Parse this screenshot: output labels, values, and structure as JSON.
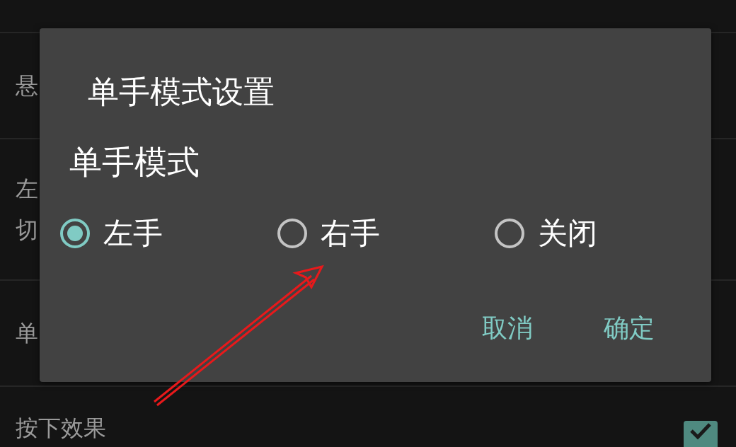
{
  "background_list": [
    {
      "lines": [
        "悬"
      ]
    },
    {
      "lines": [
        "左",
        "切"
      ]
    },
    {
      "lines": [
        "单"
      ]
    },
    {
      "lines": [
        "按下效果"
      ],
      "checked": true
    }
  ],
  "dialog": {
    "title": "单手模式设置",
    "section_label": "单手模式",
    "options": [
      {
        "label": "左手",
        "selected": true
      },
      {
        "label": "右手",
        "selected": false
      },
      {
        "label": "关闭",
        "selected": false
      }
    ],
    "buttons": [
      "取消",
      "确定"
    ]
  }
}
